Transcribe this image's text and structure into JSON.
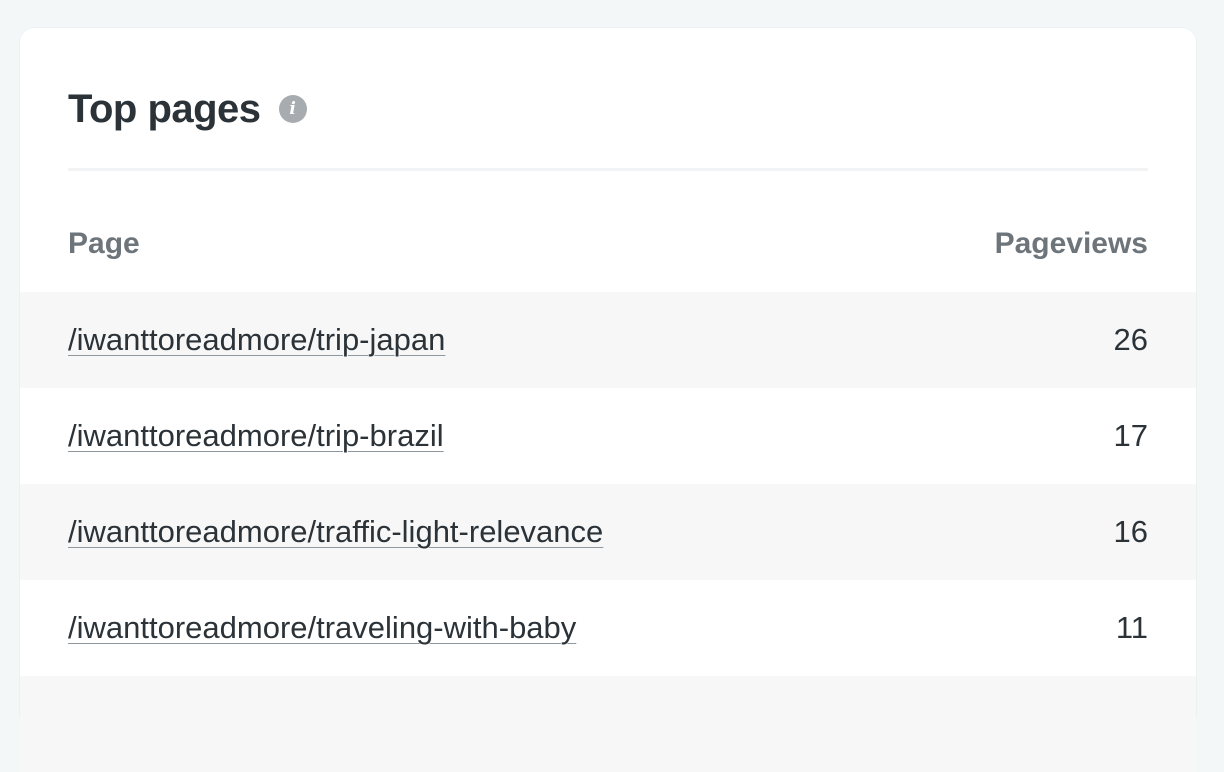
{
  "card": {
    "title": "Top pages",
    "info_icon": "info-icon",
    "info_glyph": "i"
  },
  "table": {
    "columns": {
      "page": "Page",
      "pageviews": "Pageviews"
    },
    "rows": [
      {
        "page": "/iwanttoreadmore/trip-japan",
        "pageviews": "26"
      },
      {
        "page": "/iwanttoreadmore/trip-brazil",
        "pageviews": "17"
      },
      {
        "page": "/iwanttoreadmore/traffic-light-relevance",
        "pageviews": "16"
      },
      {
        "page": "/iwanttoreadmore/traveling-with-baby",
        "pageviews": "11"
      },
      {
        "page": "",
        "pageviews": ""
      }
    ]
  },
  "colors": {
    "background": "#f4f7f8",
    "card": "#ffffff",
    "text": "#2b3339",
    "muted": "#6d757b",
    "stripe": "#f7f7f7"
  }
}
